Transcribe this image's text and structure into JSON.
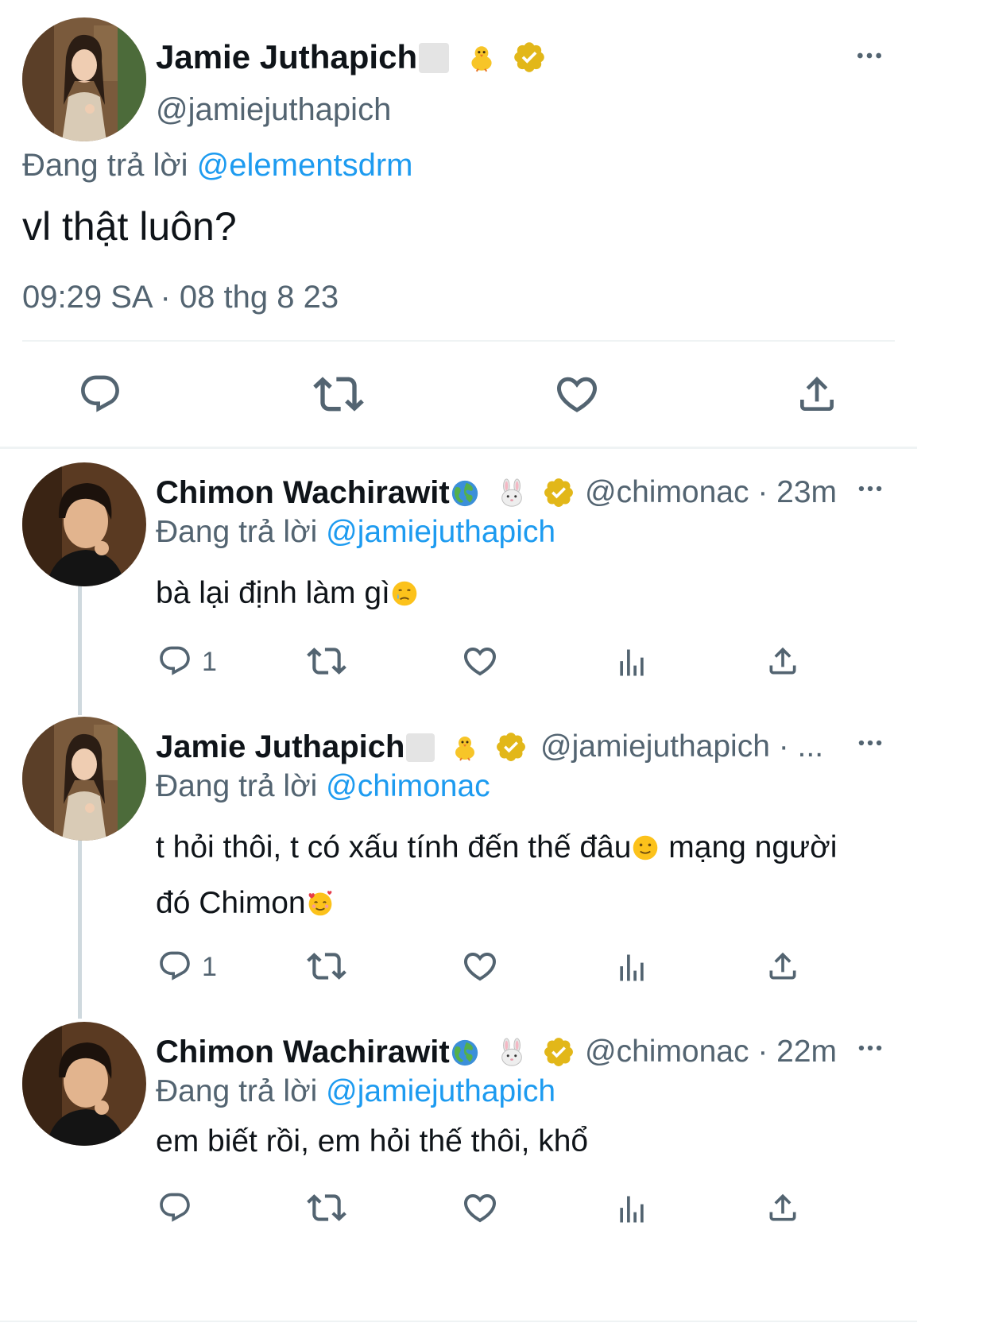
{
  "main_tweet": {
    "author_name": "Jamie Juthapich",
    "author_handle": "@jamiejuthapich",
    "replying_prefix": "Đang trả lời",
    "replying_to": "@elementsdrm",
    "text": "vl thật luôn?",
    "timestamp": "09:29 SA · 08 thg 8 23"
  },
  "replies": [
    {
      "author_name": "Chimon Wachirawit",
      "meta": "@chimonac · 23m",
      "replying_prefix": "Đang trả lời",
      "replying_to": "@jamiejuthapich",
      "text": "bà lại định làm gì",
      "reply_count": "1"
    },
    {
      "author_name": "Jamie Juthapich",
      "meta": "@jamiejuthapich · ...",
      "replying_prefix": "Đang trả lời",
      "replying_to": "@chimonac",
      "text_line1": "t hỏi thôi, t có xấu tính đến thế đâu",
      "text_line1_end": " mạng người",
      "text_line2": "đó Chimon",
      "reply_count": "1"
    },
    {
      "author_name": "Chimon Wachirawit",
      "meta": "@chimonac · 22m",
      "replying_prefix": "Đang trả lời",
      "replying_to": "@jamiejuthapich",
      "text": "em biết rồi, em hỏi thế thôi, khổ"
    }
  ],
  "colors": {
    "text": "#0f1419",
    "secondary": "#536471",
    "mention": "#1d9bf0",
    "verified": "#e2b719",
    "divider": "#eff3f4"
  },
  "icons": [
    "more-icon",
    "reply-icon",
    "retweet-icon",
    "like-icon",
    "share-icon",
    "views-icon",
    "verified-badge-icon",
    "chick-emoji-icon",
    "globe-emoji-icon",
    "rabbit-emoji-icon"
  ]
}
